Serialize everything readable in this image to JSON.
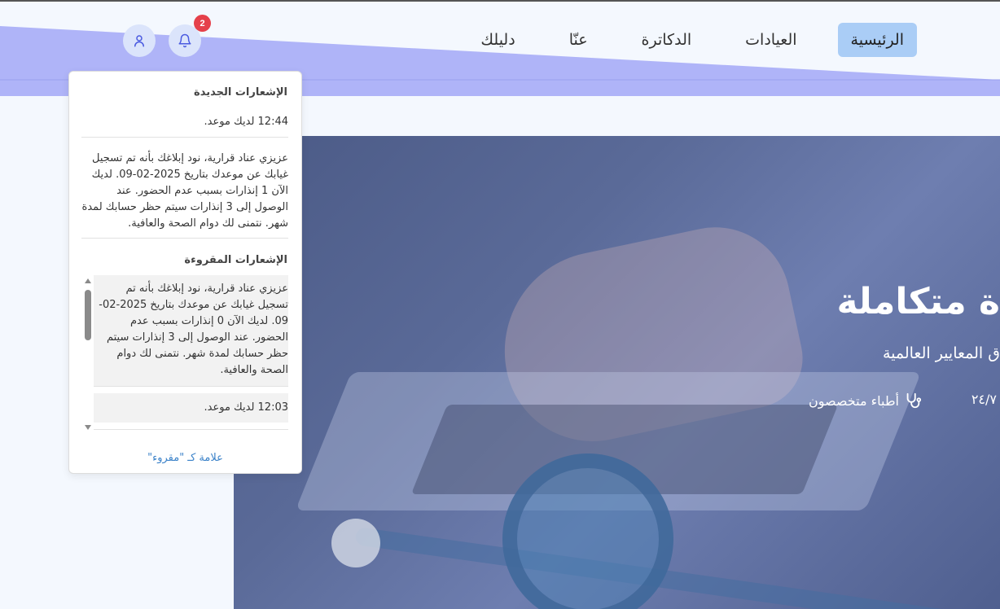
{
  "nav": {
    "items": [
      {
        "label": "الرئيسية",
        "active": true
      },
      {
        "label": "العيادات",
        "active": false
      },
      {
        "label": "الدكاترة",
        "active": false
      },
      {
        "label": "عنّا",
        "active": false
      },
      {
        "label": "دليلك",
        "active": false
      }
    ]
  },
  "header": {
    "notification_count": "2",
    "bell_icon": "bell-icon",
    "user_icon": "user-icon",
    "band_color": "#afb4f8",
    "badge_color": "#e5404a"
  },
  "hero": {
    "title": "ة متكاملة",
    "subtitle": "ق المعايير العالمية",
    "stat_doctors": "أطباء متخصصون",
    "stat_hours": "٢٤/٧",
    "stat_icon": "stethoscope-icon"
  },
  "notifications": {
    "new_heading": "الإشعارات الجديدة",
    "new_items": [
      "12:44 لديك موعد.",
      "عزيزي عناد قرارية، نود إبلاغك بأنه تم تسجيل غيابك عن موعدك بتاريخ 2025-02-09. لديك الآن 1 إنذارات بسبب عدم الحضور. عند الوصول إلى 3 إنذارات سيتم حظر حسابك لمدة شهر. نتمنى لك دوام الصحة والعافية."
    ],
    "read_heading": "الإشعارات المقروءة",
    "read_items": [
      "عزيزي عناد قرارية، نود إبلاغك بأنه تم تسجيل غيابك عن موعدك بتاريخ 2025-02-09. لديك الآن 0 إنذارات بسبب عدم الحضور. عند الوصول إلى 3 إنذارات سيتم حظر حسابك لمدة شهر. نتمنى لك دوام الصحة والعافية.",
      "12:03 لديك موعد."
    ],
    "mark_read": "علامة كـ \"مقروء\"",
    "link_color": "#3b82c9"
  }
}
